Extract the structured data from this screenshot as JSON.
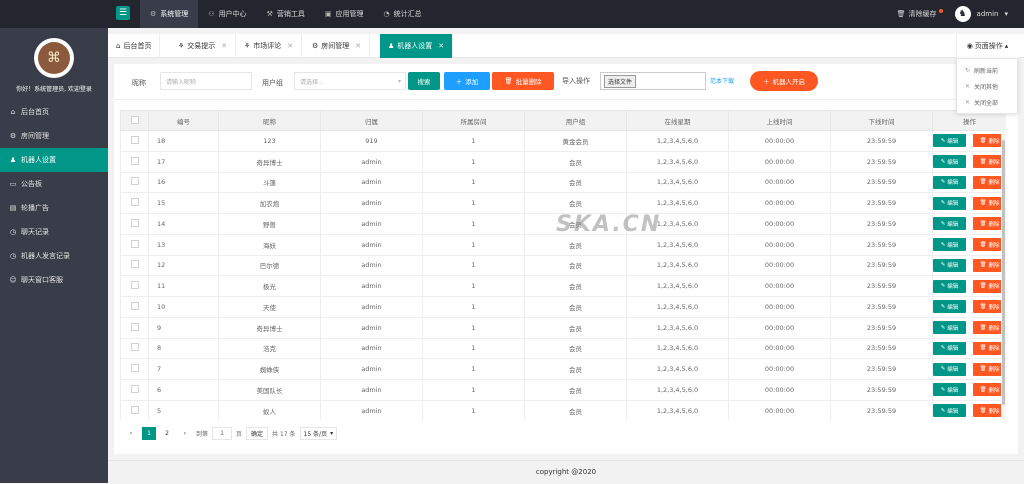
{
  "topbar": {
    "nav": [
      {
        "label": "系统管理",
        "icon": "gear-icon",
        "glyph": "⚙",
        "active": true
      },
      {
        "label": "用户中心",
        "icon": "user-icon",
        "glyph": "⚇",
        "active": false
      },
      {
        "label": "营销工具",
        "icon": "tools-icon",
        "glyph": "⚒",
        "active": false
      },
      {
        "label": "应用管理",
        "icon": "app-icon",
        "glyph": "▣",
        "active": false
      },
      {
        "label": "统计汇总",
        "icon": "chart-icon",
        "glyph": "◔",
        "active": false
      }
    ],
    "clear_cache": "清除缓存",
    "username": "admin"
  },
  "sidebar": {
    "welcome": "你好！系统管理员, 欢迎登录",
    "items": [
      {
        "label": "后台首页",
        "icon": "home-icon",
        "glyph": "⌂"
      },
      {
        "label": "房间管理",
        "icon": "gear-icon",
        "glyph": "⚙"
      },
      {
        "label": "机器人设置",
        "icon": "user-icon",
        "glyph": "♟"
      },
      {
        "label": "公告板",
        "icon": "board-icon",
        "glyph": "▭"
      },
      {
        "label": "轮播广告",
        "icon": "image-icon",
        "glyph": "▤"
      },
      {
        "label": "聊天记录",
        "icon": "clock-icon",
        "glyph": "◷"
      },
      {
        "label": "机器人发言记录",
        "icon": "clock-icon",
        "glyph": "◷"
      },
      {
        "label": "聊天窗口客服",
        "icon": "chat-icon",
        "glyph": "☺"
      }
    ],
    "active_index": 2
  },
  "tabs": [
    {
      "label": "后台首页",
      "closable": false
    },
    {
      "label": "交易提示",
      "closable": true
    },
    {
      "label": "市场评论",
      "closable": true
    },
    {
      "label": "房间管理",
      "closable": true
    },
    {
      "label": "机器人设置",
      "closable": true
    }
  ],
  "page_ops": {
    "label": "页面操作",
    "items": [
      {
        "label": "刷新当前",
        "glyph": "↻"
      },
      {
        "label": "关闭其他",
        "glyph": "✕"
      },
      {
        "label": "关闭全部",
        "glyph": "✕"
      }
    ]
  },
  "toolbar": {
    "nickname_label": "昵称",
    "nickname_placeholder": "请输入昵称",
    "group_label": "用户组",
    "group_placeholder": "请选择...",
    "search": "搜索",
    "add": "添加",
    "batch_delete": "批量删除",
    "import_label": "导入操作",
    "choose_file": "选择文件",
    "template_download": "范本下载",
    "robot_start": "机器人开启"
  },
  "table": {
    "headers": [
      "编号",
      "昵称",
      "归属",
      "所属房间",
      "用户组",
      "在线星期",
      "上线时间",
      "下线时间",
      "操作"
    ],
    "edit_label": "编辑",
    "delete_label": "删除",
    "rows": [
      {
        "id": "18",
        "nick": "123",
        "owner": "919",
        "room": "1",
        "group": "黄金会员",
        "week": "1,2,3,4,5,6,0",
        "on": "00:00:00",
        "off": "23:59:59"
      },
      {
        "id": "17",
        "nick": "奇异博士",
        "owner": "admin",
        "room": "1",
        "group": "会员",
        "week": "1,2,3,4,5,6,0",
        "on": "00:00:00",
        "off": "23:59:59"
      },
      {
        "id": "16",
        "nick": "斗篷",
        "owner": "admin",
        "room": "1",
        "group": "会员",
        "week": "1,2,3,4,5,6,0",
        "on": "00:00:00",
        "off": "23:59:59"
      },
      {
        "id": "15",
        "nick": "加农炮",
        "owner": "admin",
        "room": "1",
        "group": "会员",
        "week": "1,2,3,4,5,6,0",
        "on": "00:00:00",
        "off": "23:59:59"
      },
      {
        "id": "14",
        "nick": "野兽",
        "owner": "admin",
        "room": "1",
        "group": "会员",
        "week": "1,2,3,4,5,6,0",
        "on": "00:00:00",
        "off": "23:59:59"
      },
      {
        "id": "13",
        "nick": "海妖",
        "owner": "admin",
        "room": "1",
        "group": "会员",
        "week": "1,2,3,4,5,6,0",
        "on": "00:00:00",
        "off": "23:59:59"
      },
      {
        "id": "12",
        "nick": "巴尔德",
        "owner": "admin",
        "room": "1",
        "group": "会员",
        "week": "1,2,3,4,5,6,0",
        "on": "00:00:00",
        "off": "23:59:59"
      },
      {
        "id": "11",
        "nick": "极光",
        "owner": "admin",
        "room": "1",
        "group": "会员",
        "week": "1,2,3,4,5,6,0",
        "on": "00:00:00",
        "off": "23:59:59"
      },
      {
        "id": "10",
        "nick": "天使",
        "owner": "admin",
        "room": "1",
        "group": "会员",
        "week": "1,2,3,4,5,6,0",
        "on": "00:00:00",
        "off": "23:59:59"
      },
      {
        "id": "9",
        "nick": "奇异博士",
        "owner": "admin",
        "room": "1",
        "group": "会员",
        "week": "1,2,3,4,5,6,0",
        "on": "00:00:00",
        "off": "23:59:59"
      },
      {
        "id": "8",
        "nick": "浩克",
        "owner": "admin",
        "room": "1",
        "group": "会员",
        "week": "1,2,3,4,5,6,0",
        "on": "00:00:00",
        "off": "23:59:59"
      },
      {
        "id": "7",
        "nick": "蜘蛛侠",
        "owner": "admin",
        "room": "1",
        "group": "会员",
        "week": "1,2,3,4,5,6,0",
        "on": "00:00:00",
        "off": "23:59:59"
      },
      {
        "id": "6",
        "nick": "美国队长",
        "owner": "admin",
        "room": "1",
        "group": "会员",
        "week": "1,2,3,4,5,6,0",
        "on": "00:00:00",
        "off": "23:59:59"
      },
      {
        "id": "5",
        "nick": "蚁人",
        "owner": "admin",
        "room": "1",
        "group": "会员",
        "week": "1,2,3,4,5,6,0",
        "on": "00:00:00",
        "off": "23:59:59"
      }
    ]
  },
  "pager": {
    "pages": [
      "1",
      "2"
    ],
    "current": "1",
    "goto_label": "到第",
    "page_input": "1",
    "page_unit": "页",
    "confirm": "确定",
    "total": "共 17 条",
    "per_page": "15 条/页"
  },
  "footer": "copyright @2020",
  "watermark": "SKA.CN",
  "colors": {
    "accent": "#009688",
    "blue": "#1e9fff",
    "danger": "#ff5722",
    "topbar": "#23262e",
    "sidebar": "#393d49"
  }
}
